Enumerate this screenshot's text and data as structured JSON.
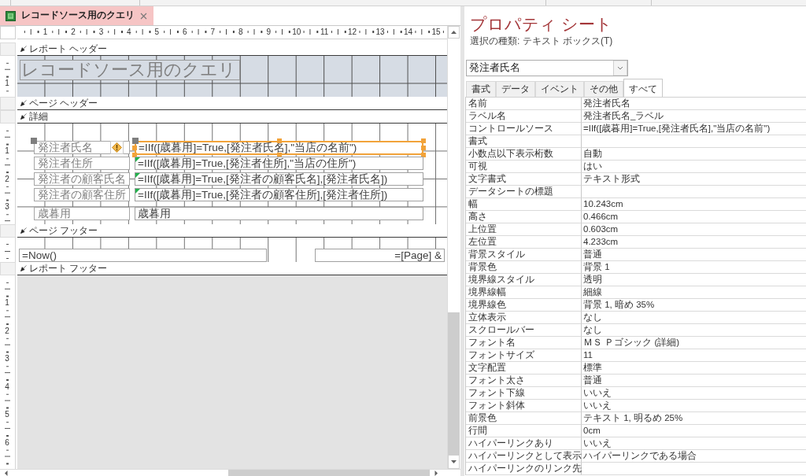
{
  "document_tab": {
    "title": "レコードソース用のクエリ",
    "selected": true
  },
  "horizontal_ruler": {
    "marks": [
      "1",
      "2",
      "3",
      "4",
      "5",
      "6",
      "7",
      "8",
      "9",
      "10",
      "11",
      "12",
      "13",
      "14",
      "15"
    ]
  },
  "sections": [
    {
      "kind": "report_header",
      "title": "レポート ヘッダー",
      "ruler_marks": [
        "1"
      ],
      "controls": [
        {
          "kind": "title_label",
          "text": "レコードソース用のクエリ"
        }
      ]
    },
    {
      "kind": "page_header",
      "title": "ページ ヘッダー"
    },
    {
      "kind": "detail",
      "title": "詳細",
      "ruler_marks": [
        "1",
        "2",
        "3"
      ],
      "rows": [
        {
          "label": "発注者氏名",
          "expression": "=IIf([歳暮用]=True,[発注者氏名],\"当店の名前\")",
          "selected": true,
          "warning": true,
          "error_indicator": false
        },
        {
          "label": "発注者住所",
          "expression": "=IIf([歳暮用]=True,[発注者住所],\"当店の住所\")",
          "selected": false,
          "warning": false,
          "error_indicator": true
        },
        {
          "label": "発注者の顧客氏名",
          "expression": "=IIf([歳暮用]=True,[発注者の顧客氏名],[発注者氏名])",
          "selected": false,
          "warning": false,
          "error_indicator": true
        },
        {
          "label": "発注者の顧客住所",
          "expression": "=IIf([歳暮用]=True,[発注者の顧客住所],[発注者住所])",
          "selected": false,
          "warning": false,
          "error_indicator": true
        },
        {
          "label": "歳暮用",
          "expression": "歳暮用",
          "selected": false,
          "warning": false,
          "error_indicator": false
        }
      ]
    },
    {
      "kind": "page_footer",
      "title": "ページ フッター",
      "controls": [
        {
          "kind": "textbox",
          "text": "=Now()"
        },
        {
          "kind": "textbox",
          "text": "=[Page] &"
        }
      ]
    },
    {
      "kind": "report_footer",
      "title": "レポート フッター"
    }
  ],
  "canvas": {
    "ruler_marks": [
      "1",
      "2",
      "3",
      "4",
      "5",
      "6"
    ]
  },
  "property_sheet": {
    "title": "プロパティ シート",
    "selection_type": "選択の種類: テキスト ボックス(T)",
    "object_selector": {
      "value": "発注者氏名"
    },
    "tabs": [
      {
        "label": "書式",
        "selected": false
      },
      {
        "label": "データ",
        "selected": false
      },
      {
        "label": "イベント",
        "selected": false
      },
      {
        "label": "その他",
        "selected": false
      },
      {
        "label": "すべて",
        "selected": true
      }
    ],
    "properties": [
      {
        "name": "名前",
        "value": "発注者氏名"
      },
      {
        "name": "ラベル名",
        "value": "発注者氏名_ラベル"
      },
      {
        "name": "コントロールソース",
        "value": "=IIf([歳暮用]=True,[発注者氏名],\"当店の名前\")"
      },
      {
        "name": "書式"
      },
      {
        "name": "小数点以下表示桁数",
        "value": "自動"
      },
      {
        "name": "可視",
        "value": "はい"
      },
      {
        "name": "文字書式",
        "value": "テキスト形式"
      },
      {
        "name": "データシートの標題"
      },
      {
        "name": "幅",
        "value": "10.243cm"
      },
      {
        "name": "高さ",
        "value": "0.466cm"
      },
      {
        "name": "上位置",
        "value": "0.603cm"
      },
      {
        "name": "左位置",
        "value": "4.233cm"
      },
      {
        "name": "背景スタイル",
        "value": "普通"
      },
      {
        "name": "背景色",
        "value": "背景 1"
      },
      {
        "name": "境界線スタイル",
        "value": "透明"
      },
      {
        "name": "境界線幅",
        "value": "細線"
      },
      {
        "name": "境界線色",
        "value": "背景 1, 暗め 35%"
      },
      {
        "name": "立体表示",
        "value": "なし"
      },
      {
        "name": "スクロールバー",
        "value": "なし"
      },
      {
        "name": "フォント名",
        "value": "ＭＳ Ｐゴシック (詳細)"
      },
      {
        "name": "フォントサイズ",
        "value": "11"
      },
      {
        "name": "文字配置",
        "value": "標準"
      },
      {
        "name": "フォント太さ",
        "value": "普通"
      },
      {
        "name": "フォント下線",
        "value": "いいえ"
      },
      {
        "name": "フォント斜体",
        "value": "いいえ"
      },
      {
        "name": "前景色",
        "value": "テキスト 1, 明るめ 25%"
      },
      {
        "name": "行間",
        "value": "0cm"
      },
      {
        "name": "ハイパーリンクあり",
        "value": "いいえ"
      },
      {
        "name": "ハイパーリンクとして表示",
        "value": "ハイパーリンクである場合"
      },
      {
        "name": "ハイパーリンクのリンク先"
      }
    ]
  }
}
